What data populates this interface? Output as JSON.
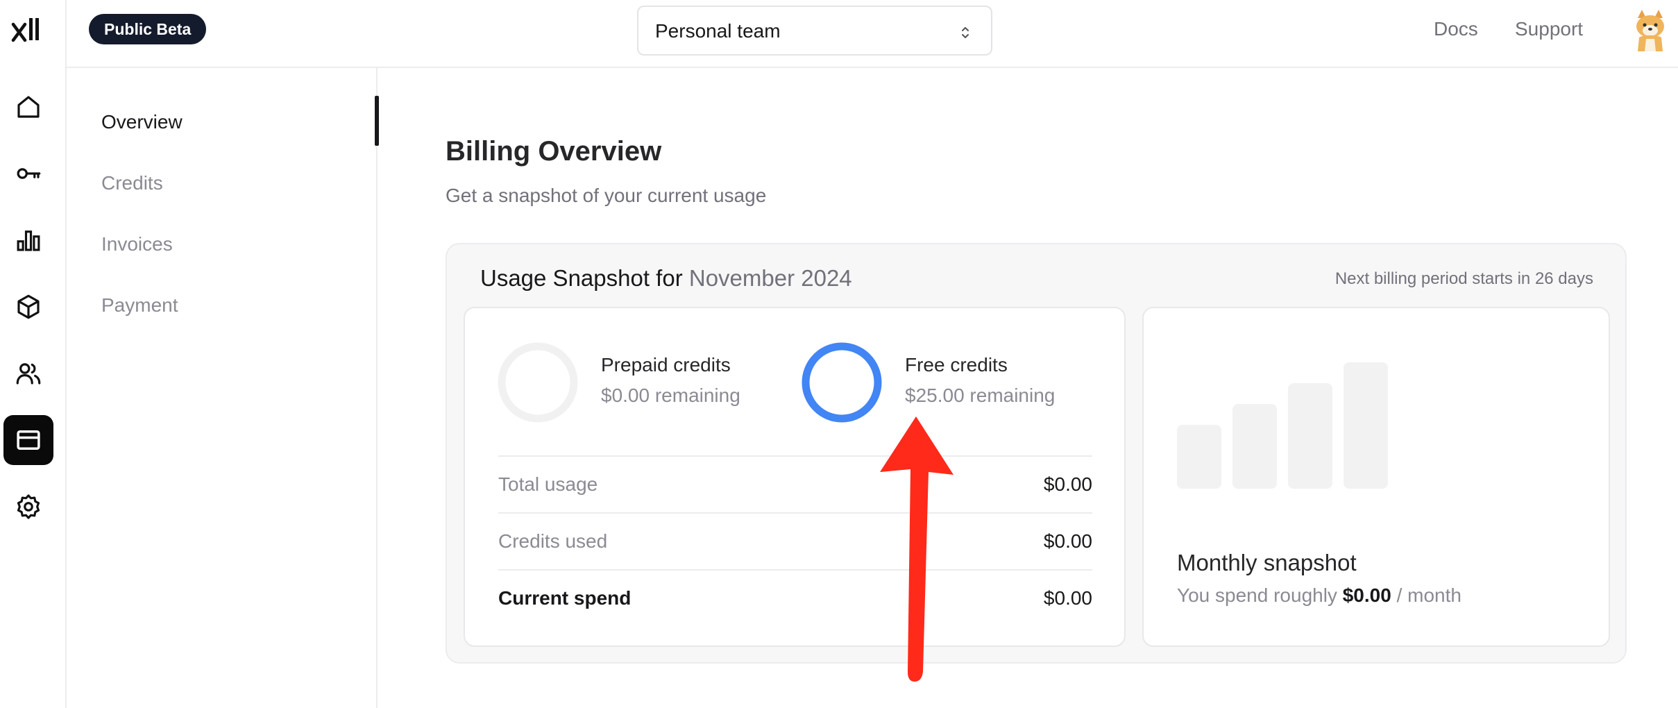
{
  "topbar": {
    "badge": "Public Beta",
    "team_selector": "Personal team",
    "links": {
      "docs": "Docs",
      "support": "Support"
    }
  },
  "rail": {
    "logo": "xi",
    "items": [
      "home-icon",
      "key-icon",
      "bar-chart-icon",
      "cube-icon",
      "users-icon",
      "billing-icon",
      "settings-icon"
    ],
    "active": "billing-icon"
  },
  "subnav": {
    "items": [
      {
        "label": "Overview",
        "active": true
      },
      {
        "label": "Credits"
      },
      {
        "label": "Invoices"
      },
      {
        "label": "Payment"
      }
    ]
  },
  "page": {
    "title": "Billing Overview",
    "subtitle": "Get a snapshot of your current usage"
  },
  "snapshot": {
    "title_prefix": "Usage Snapshot for",
    "month": "November 2024",
    "next_period": "Next billing period starts in 26 days",
    "prepaid": {
      "title": "Prepaid credits",
      "remaining": "$0.00 remaining",
      "fill": 0
    },
    "free": {
      "title": "Free credits",
      "remaining": "$25.00 remaining",
      "fill": 1.0
    },
    "rows": [
      {
        "label": "Total usage",
        "value": "$0.00"
      },
      {
        "label": "Credits used",
        "value": "$0.00"
      },
      {
        "label": "Current spend",
        "value": "$0.00"
      }
    ],
    "monthly": {
      "title": "Monthly snapshot",
      "prefix": "You spend roughly",
      "amount": "$0.00",
      "suffix": "/ month"
    }
  },
  "colors": {
    "accent_blue": "#4285f4",
    "arrow_red": "#ff2a1a",
    "active_dark": "#0a0a0a"
  }
}
